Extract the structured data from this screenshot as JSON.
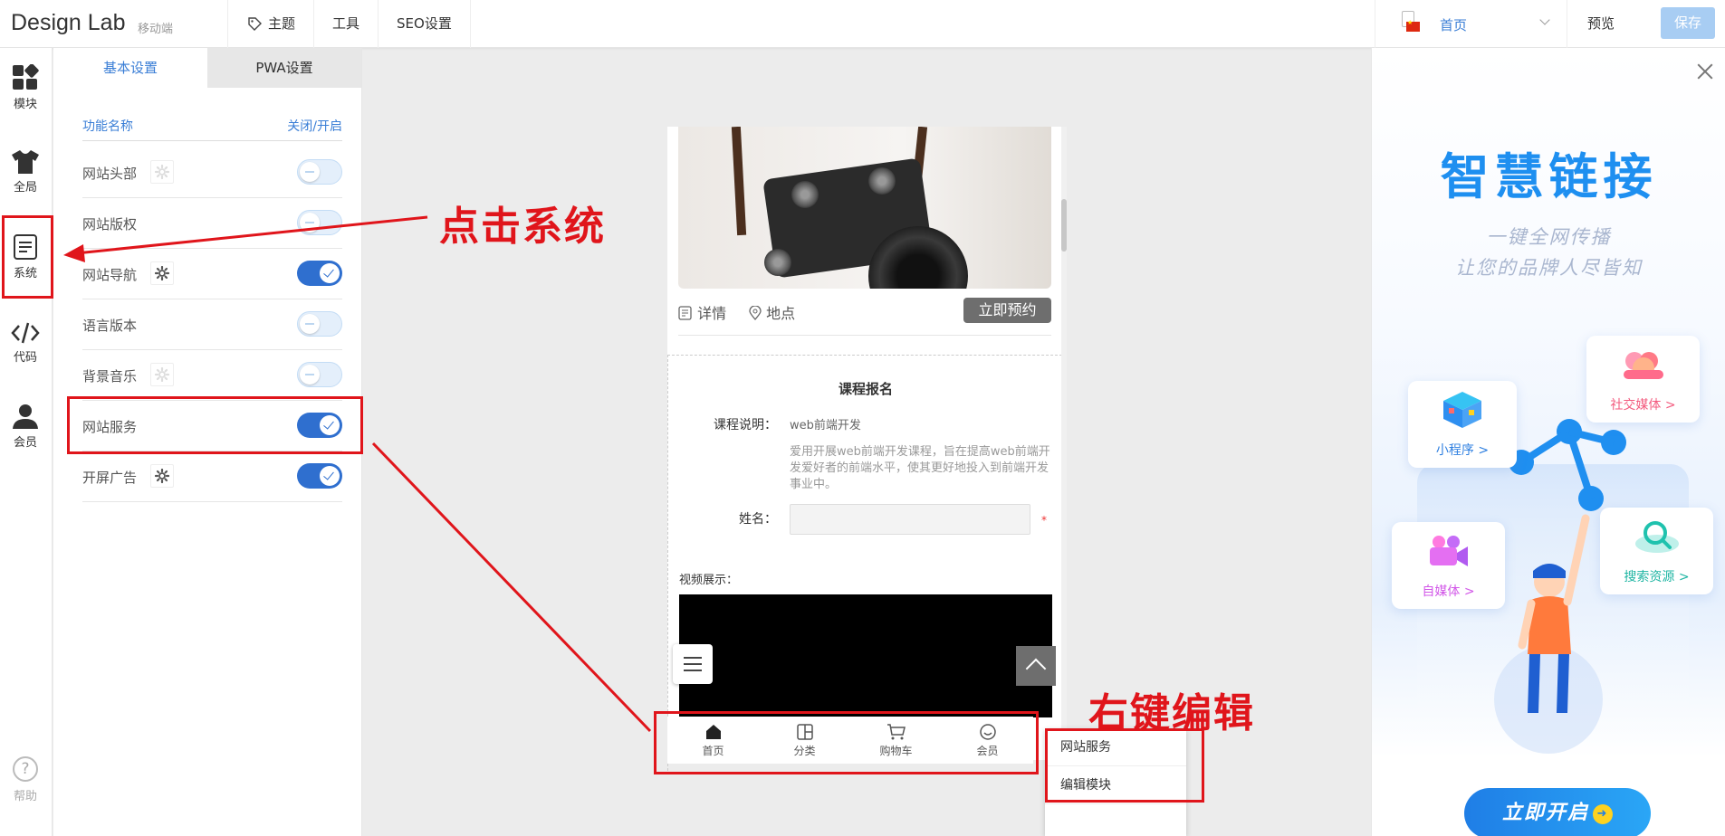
{
  "app": {
    "logo": "Design Lab",
    "mode": "移动端"
  },
  "topnav": {
    "theme": "主题",
    "tools": "工具",
    "seo": "SEO设置"
  },
  "page_select": {
    "current": "首页"
  },
  "actions": {
    "preview": "预览",
    "save": "保存"
  },
  "iconbar": {
    "modules": "模块",
    "global": "全局",
    "system": "系统",
    "code": "代码",
    "member": "会员",
    "help": "帮助"
  },
  "panel": {
    "tabs": [
      "基本设置",
      "PWA设置"
    ],
    "header_name": "功能名称",
    "header_toggle": "关闭/开启",
    "rows": [
      {
        "label": "网站头部",
        "gear": true,
        "gear_enabled": false,
        "on": false
      },
      {
        "label": "网站版权",
        "gear": false,
        "gear_enabled": false,
        "on": false
      },
      {
        "label": "网站导航",
        "gear": true,
        "gear_enabled": true,
        "on": true
      },
      {
        "label": "语言版本",
        "gear": false,
        "gear_enabled": false,
        "on": false
      },
      {
        "label": "背景音乐",
        "gear": true,
        "gear_enabled": false,
        "on": false
      },
      {
        "label": "网站服务",
        "gear": false,
        "gear_enabled": false,
        "on": true
      },
      {
        "label": "开屏广告",
        "gear": true,
        "gear_enabled": true,
        "on": true
      }
    ]
  },
  "phone": {
    "detail": "详情",
    "location": "地点",
    "book": "立即预约",
    "form_title": "课程报名",
    "course_label": "课程说明：",
    "course_value": "web前端开发",
    "course_desc": "爱用开展web前端开发课程，旨在提高web前端开发爱好者的前端水平，使其更好地投入到前端开发事业中。",
    "name_label": "姓名：",
    "required_mark": "*",
    "video_label": "视频展示："
  },
  "bottom_nav": [
    "首页",
    "分类",
    "购物车",
    "会员"
  ],
  "context_menu": [
    "网站服务",
    "编辑模块"
  ],
  "annotations": {
    "click_system": "点击系统",
    "right_click_edit": "右键编辑"
  },
  "ad": {
    "title": "智慧链接",
    "sub1": "一键全网传播",
    "sub2": "让您的品牌人尽皆知",
    "card_mini": "小程序 >",
    "card_social": "社交媒体 >",
    "card_media": "自媒体 >",
    "card_search": "搜索资源 >",
    "cta": "立即开启"
  },
  "colors": {
    "accent": "#3a7ed6",
    "annotation": "#e0151b",
    "toggle_on": "#2f6fcf"
  }
}
